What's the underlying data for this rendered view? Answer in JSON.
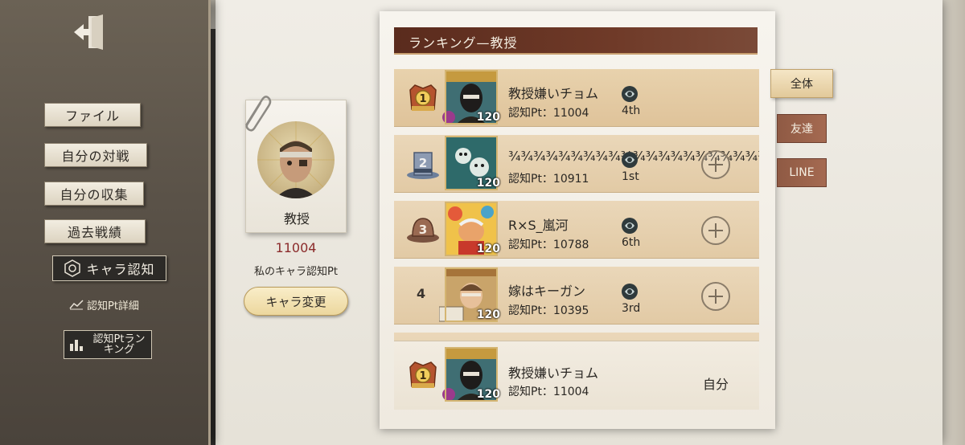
{
  "sidebar": {
    "items": [
      {
        "label": "ファイル"
      },
      {
        "label": "自分の対戦"
      },
      {
        "label": "自分の収集"
      },
      {
        "label": "過去戦績"
      },
      {
        "label": "キャラ認知"
      }
    ],
    "sub_label": "認知Pt詳細",
    "ranking_button": {
      "line1": "認知Ptラン",
      "line2": "キング"
    }
  },
  "character": {
    "name": "教授",
    "points": "11004",
    "points_label": "私のキャラ認知Pt",
    "change_button": "キャラ変更"
  },
  "ranking": {
    "title": "ランキング—教授",
    "rows": [
      {
        "rank": "1",
        "level": "120",
        "name": "教授嫌いチョム",
        "pt": "認知Pt：11004",
        "tier": "4th",
        "add": false
      },
      {
        "rank": "2",
        "level": "120",
        "name": "¾¾¾¾¾¾¾¾¾¾¾¾¾¾¾¾¾¾¾¾¾",
        "pt": "認知Pt：10911",
        "tier": "1st",
        "add": true
      },
      {
        "rank": "3",
        "level": "120",
        "name": "R×S_嵐河",
        "pt": "認知Pt：10788",
        "tier": "6th",
        "add": true
      },
      {
        "rank": "4",
        "level": "120",
        "name": "嫁はキーガン",
        "pt": "認知Pt：10395",
        "tier": "3rd",
        "add": true
      }
    ],
    "self": {
      "rank": "1",
      "level": "120",
      "name": "教授嫌いチョム",
      "pt": "認知Pt：11004",
      "label": "自分"
    }
  },
  "tabs": [
    {
      "label": "全体",
      "active": true
    },
    {
      "label": "友達",
      "active": false
    },
    {
      "label": "LINE",
      "active": false
    }
  ],
  "colors": {
    "accent": "#6f3a28",
    "points": "#8b2b2b",
    "row": "#e2caa5"
  }
}
